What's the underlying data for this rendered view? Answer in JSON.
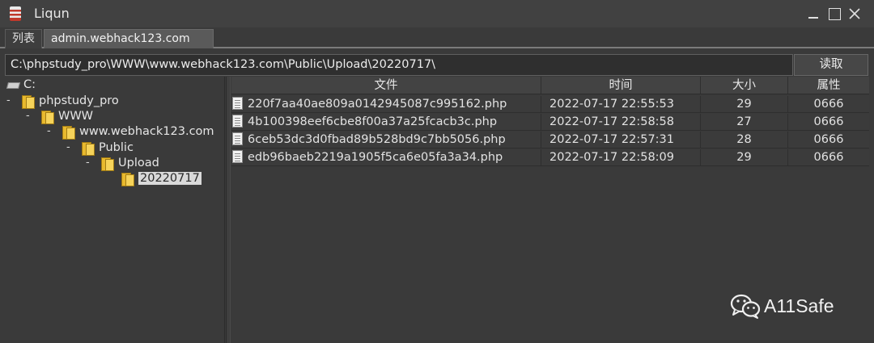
{
  "window": {
    "title": "Liqun"
  },
  "tabs": [
    {
      "label": "列表"
    },
    {
      "label": "admin.webhack123.com"
    }
  ],
  "path_bar": {
    "value": "C:\\phpstudy_pro\\WWW\\www.webhack123.com\\Public\\Upload\\20220717\\",
    "read_label": "读取"
  },
  "tree": [
    {
      "label": "C:",
      "toggle": ""
    },
    {
      "label": "phpstudy_pro",
      "toggle": "-"
    },
    {
      "label": "WWW",
      "toggle": "-"
    },
    {
      "label": "www.webhack123.com",
      "toggle": "-"
    },
    {
      "label": "Public",
      "toggle": "-"
    },
    {
      "label": "Upload",
      "toggle": "-"
    },
    {
      "label": "20220717",
      "toggle": ""
    }
  ],
  "table": {
    "headers": {
      "file": "文件",
      "time": "时间",
      "size": "大小",
      "attr": "属性"
    },
    "rows": [
      {
        "file": "220f7aa40ae809a0142945087c995162.php",
        "time": "2022-07-17 22:55:53",
        "size": "29",
        "attr": "0666"
      },
      {
        "file": "4b100398eef6cbe8f00a37a25fcacb3c.php",
        "time": "2022-07-17 22:58:58",
        "size": "27",
        "attr": "0666"
      },
      {
        "file": "6ceb53dc3d0fbad89b528bd9c7bb5056.php",
        "time": "2022-07-17 22:57:31",
        "size": "28",
        "attr": "0666"
      },
      {
        "file": "edb96baeb2219a1905f5ca6e05fa3a34.php",
        "time": "2022-07-17 22:58:09",
        "size": "29",
        "attr": "0666"
      }
    ]
  },
  "watermark": {
    "text": "A11Safe"
  },
  "colors": {
    "background": "#3a3a3a",
    "folder": "#e8b92e",
    "selection": "#d9d9d9"
  }
}
